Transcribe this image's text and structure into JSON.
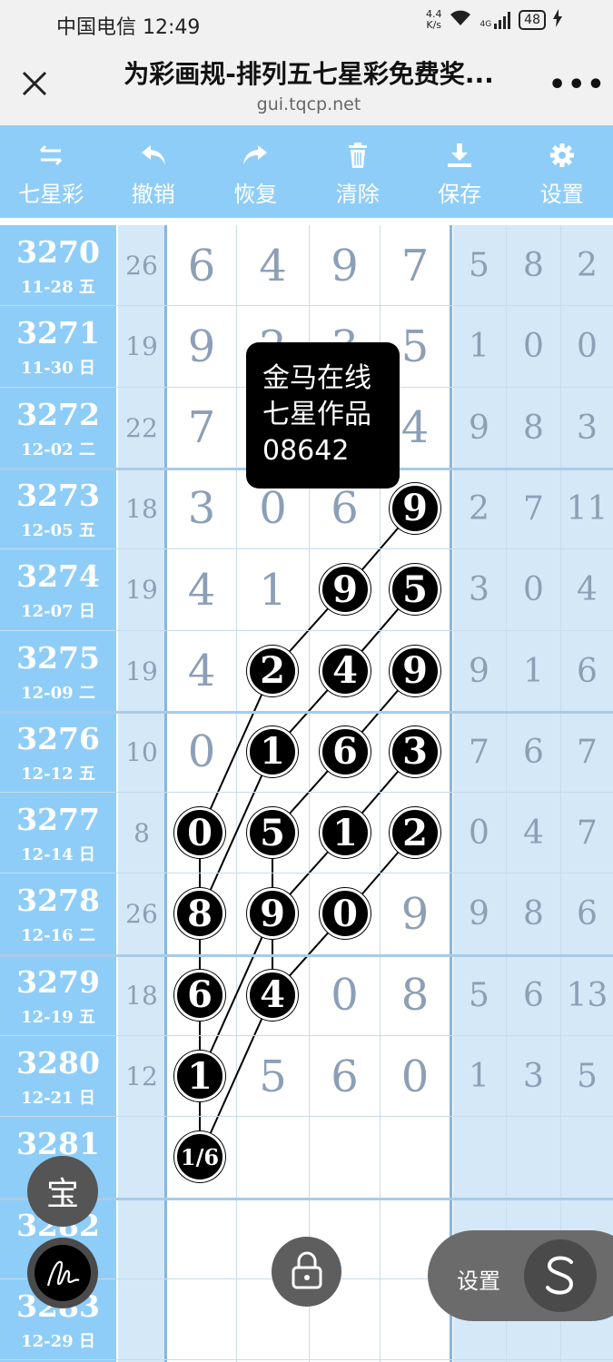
{
  "status_bar": {
    "carrier_time": "中国电信 12:49",
    "speed_value": "4.4",
    "speed_unit": "K/s",
    "network": "4G",
    "battery": "48"
  },
  "title_bar": {
    "title": "为彩画规-排列五七星彩免费奖...",
    "url": "gui.tqcp.net",
    "more": "•••"
  },
  "toolbar": [
    {
      "label": "七星彩",
      "icon": "swap-arrows-icon"
    },
    {
      "label": "撤销",
      "icon": "undo-icon"
    },
    {
      "label": "恢复",
      "icon": "redo-icon"
    },
    {
      "label": "清除",
      "icon": "trash-icon"
    },
    {
      "label": "保存",
      "icon": "download-icon"
    },
    {
      "label": "设置",
      "icon": "gear-icon"
    }
  ],
  "rows": [
    {
      "period": "3270",
      "date": "11-28 五",
      "sum": "26",
      "main": [
        "6",
        "4",
        "9",
        "7"
      ],
      "right": [
        "5",
        "8",
        "2"
      ]
    },
    {
      "period": "3271",
      "date": "11-30 日",
      "sum": "19",
      "main": [
        "9",
        "2",
        "3",
        "5"
      ],
      "right": [
        "1",
        "0",
        "0"
      ]
    },
    {
      "period": "3272",
      "date": "12-02 二",
      "sum": "22",
      "main": [
        "7",
        "",
        "",
        "4"
      ],
      "right": [
        "9",
        "8",
        "3"
      ]
    },
    {
      "period": "3273",
      "date": "12-05 五",
      "sum": "18",
      "main": [
        "3",
        "0",
        "6",
        ""
      ],
      "right": [
        "2",
        "7",
        "11"
      ]
    },
    {
      "period": "3274",
      "date": "12-07 日",
      "sum": "19",
      "main": [
        "4",
        "1",
        "",
        ""
      ],
      "right": [
        "3",
        "0",
        "4"
      ]
    },
    {
      "period": "3275",
      "date": "12-09 二",
      "sum": "19",
      "main": [
        "4",
        "",
        "",
        ""
      ],
      "right": [
        "9",
        "1",
        "6"
      ]
    },
    {
      "period": "3276",
      "date": "12-12 五",
      "sum": "10",
      "main": [
        "0",
        "",
        "",
        ""
      ],
      "right": [
        "7",
        "6",
        "7"
      ]
    },
    {
      "period": "3277",
      "date": "12-14 日",
      "sum": "8",
      "main": [
        "",
        "",
        "",
        ""
      ],
      "right": [
        "0",
        "4",
        "7"
      ]
    },
    {
      "period": "3278",
      "date": "12-16 二",
      "sum": "26",
      "main": [
        "",
        "",
        "",
        "9"
      ],
      "right": [
        "9",
        "8",
        "6"
      ]
    },
    {
      "period": "3279",
      "date": "12-19 五",
      "sum": "18",
      "main": [
        "",
        "",
        "0",
        "8"
      ],
      "right": [
        "5",
        "6",
        "13"
      ]
    },
    {
      "period": "3280",
      "date": "12-21 日",
      "sum": "12",
      "main": [
        "",
        "5",
        "6",
        "0"
      ],
      "right": [
        "1",
        "3",
        "5"
      ]
    },
    {
      "period": "3281",
      "date": "",
      "sum": "",
      "main": [
        "",
        "",
        "",
        ""
      ],
      "right": [
        "",
        "",
        ""
      ]
    },
    {
      "period": "3282",
      "date": "",
      "sum": "",
      "main": [
        "",
        "",
        "",
        ""
      ],
      "right": [
        "",
        "",
        ""
      ]
    },
    {
      "period": "3283",
      "date": "12-29 日",
      "sum": "",
      "main": [
        "",
        "",
        "",
        ""
      ],
      "right": [
        "",
        "",
        ""
      ]
    }
  ],
  "marked": [
    {
      "row": 3,
      "col": 3,
      "text": "9"
    },
    {
      "row": 4,
      "col": 2,
      "text": "9"
    },
    {
      "row": 4,
      "col": 3,
      "text": "5"
    },
    {
      "row": 5,
      "col": 1,
      "text": "2"
    },
    {
      "row": 5,
      "col": 2,
      "text": "4"
    },
    {
      "row": 5,
      "col": 3,
      "text": "9"
    },
    {
      "row": 6,
      "col": 1,
      "text": "1"
    },
    {
      "row": 6,
      "col": 2,
      "text": "6"
    },
    {
      "row": 6,
      "col": 3,
      "text": "3"
    },
    {
      "row": 7,
      "col": 0,
      "text": "0"
    },
    {
      "row": 7,
      "col": 1,
      "text": "5"
    },
    {
      "row": 7,
      "col": 2,
      "text": "1"
    },
    {
      "row": 7,
      "col": 3,
      "text": "2"
    },
    {
      "row": 8,
      "col": 0,
      "text": "8"
    },
    {
      "row": 8,
      "col": 1,
      "text": "9"
    },
    {
      "row": 8,
      "col": 2,
      "text": "0"
    },
    {
      "row": 9,
      "col": 0,
      "text": "6"
    },
    {
      "row": 9,
      "col": 1,
      "text": "4"
    },
    {
      "row": 10,
      "col": 0,
      "text": "1"
    },
    {
      "row": 11,
      "col": 0,
      "text": "1/6"
    }
  ],
  "links": [
    [
      [
        3,
        3
      ],
      [
        4,
        2
      ],
      [
        5,
        1
      ],
      [
        7,
        0
      ],
      [
        8,
        0
      ],
      [
        9,
        0
      ],
      [
        10,
        0
      ],
      [
        11,
        0
      ]
    ],
    [
      [
        4,
        3
      ],
      [
        5,
        2
      ],
      [
        6,
        1
      ],
      [
        8,
        0
      ],
      [
        9,
        0
      ]
    ],
    [
      [
        5,
        3
      ],
      [
        6,
        2
      ],
      [
        7,
        1
      ],
      [
        8,
        1
      ],
      [
        9,
        1
      ],
      [
        11,
        0
      ]
    ],
    [
      [
        6,
        3
      ],
      [
        7,
        2
      ],
      [
        8,
        1
      ],
      [
        10,
        0
      ]
    ],
    [
      [
        7,
        3
      ],
      [
        8,
        2
      ],
      [
        9,
        1
      ]
    ]
  ],
  "tooltip": {
    "line1": "金马在线",
    "line2": "七星作品",
    "line3": "08642"
  },
  "floating": {
    "bao": "宝",
    "settings_label": "设置"
  }
}
